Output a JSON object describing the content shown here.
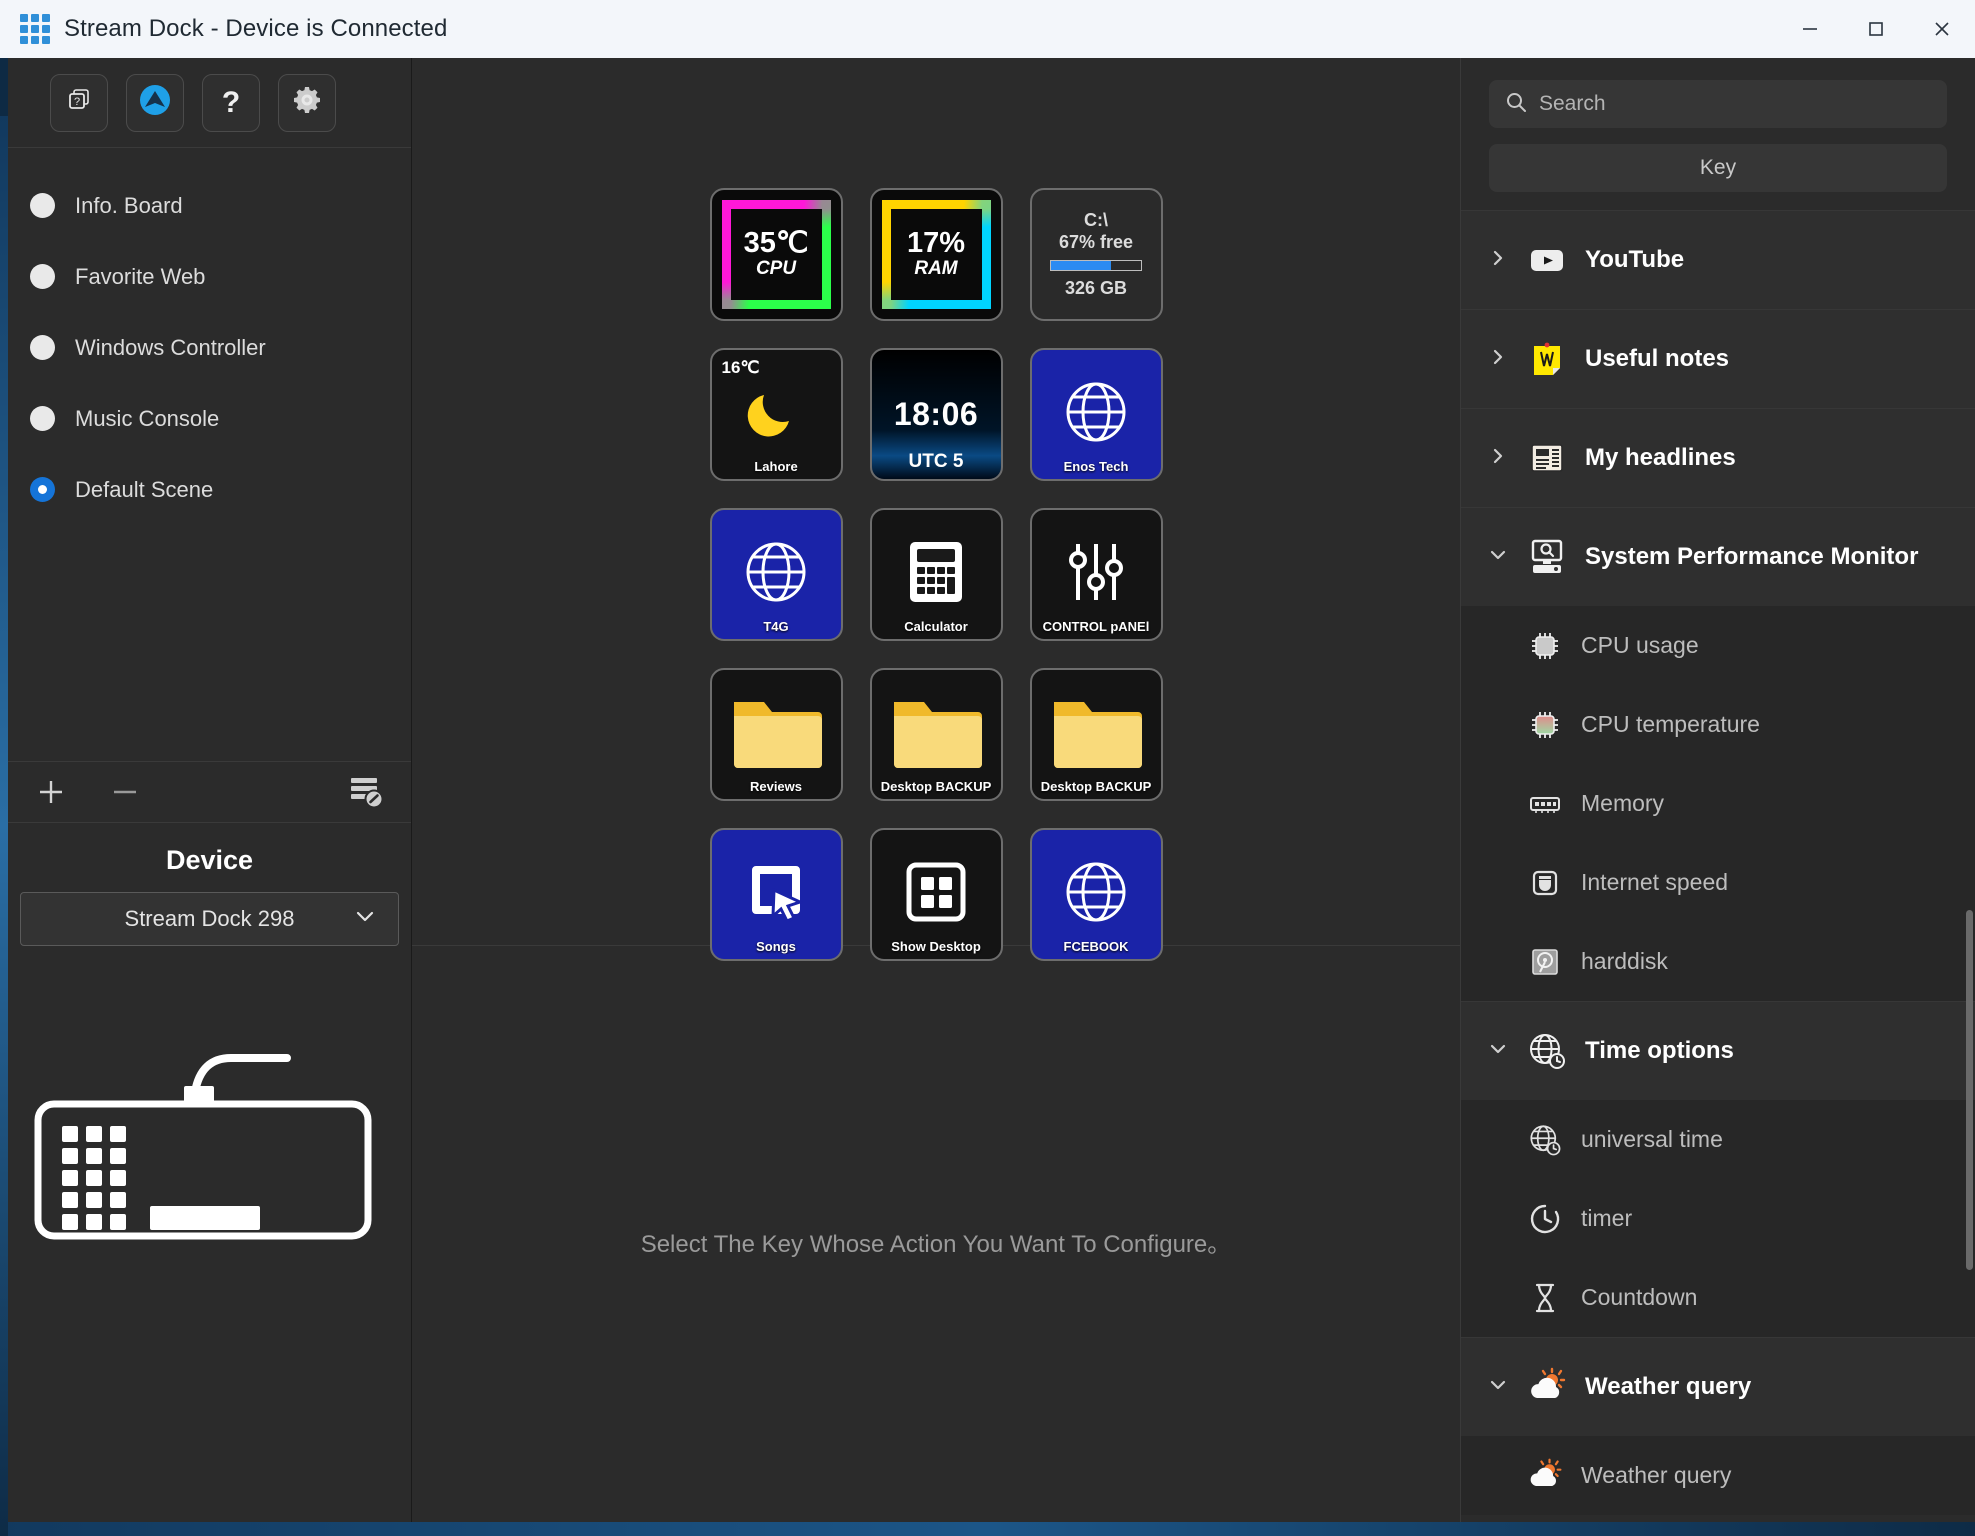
{
  "window": {
    "title": "Stream Dock - Device is Connected",
    "logo_icon": "grid-logo-icon",
    "minimize_label": "Minimize",
    "maximize_label": "Maximize",
    "close_label": "Close"
  },
  "left_toolbar": {
    "buttons": [
      {
        "name": "duplicate-button",
        "icon": "copy-layers-icon",
        "label": ""
      },
      {
        "name": "update-button",
        "icon": "upload-arrow-icon",
        "label": ""
      },
      {
        "name": "help-button",
        "icon": "question-mark-icon",
        "label": "?"
      },
      {
        "name": "settings-button",
        "icon": "gear-icon",
        "label": ""
      }
    ]
  },
  "scenes": {
    "items": [
      {
        "label": "Info. Board",
        "selected": false
      },
      {
        "label": "Favorite Web",
        "selected": false
      },
      {
        "label": "Windows Controller",
        "selected": false
      },
      {
        "label": "Music Console",
        "selected": false
      },
      {
        "label": "Default Scene",
        "selected": true
      }
    ]
  },
  "scene_actions": {
    "add_label": "+",
    "remove_label": "–",
    "config_icon": "list-edit-icon"
  },
  "device": {
    "title": "Device",
    "selected": "Stream Dock 298",
    "chevron_icon": "chevron-down-icon",
    "illustration_icon": "keyboard-device-icon"
  },
  "keygrid": {
    "keys": [
      {
        "name": "key-cpu-temp",
        "type": "neon-cpu",
        "big": "35℃",
        "sub": "CPU",
        "label": ""
      },
      {
        "name": "key-ram-usage",
        "type": "neon-ram",
        "big": "17%",
        "sub": "RAM",
        "label": ""
      },
      {
        "name": "key-disk-c",
        "type": "disk",
        "line1": "C:\\",
        "line2": "67% free",
        "line3": "326 GB",
        "bar_percent": 67,
        "label": ""
      },
      {
        "name": "key-weather-lahore",
        "type": "weather",
        "temp": "16℃",
        "icon": "moon-icon",
        "label": "Lahore"
      },
      {
        "name": "key-clock-utc5",
        "type": "clock",
        "time": "18:06",
        "zone": "UTC 5",
        "label": ""
      },
      {
        "name": "key-web-enos-tech",
        "type": "web",
        "icon": "globe-icon",
        "label": "Enos Tech"
      },
      {
        "name": "key-web-t4g",
        "type": "web",
        "icon": "globe-icon",
        "label": "T4G"
      },
      {
        "name": "key-calculator",
        "type": "app",
        "icon": "calculator-icon",
        "label": "Calculator"
      },
      {
        "name": "key-control-panel",
        "type": "app",
        "icon": "sliders-icon",
        "label": "CONTROL pANEl"
      },
      {
        "name": "key-folder-reviews",
        "type": "folder",
        "icon": "folder-icon",
        "label": "Reviews"
      },
      {
        "name": "key-folder-desktop-backup-1",
        "type": "folder",
        "icon": "folder-icon",
        "label": "Desktop BACKUP"
      },
      {
        "name": "key-folder-desktop-backup-2",
        "type": "folder",
        "icon": "folder-icon",
        "label": "Desktop BACKUP"
      },
      {
        "name": "key-songs",
        "type": "shortcut",
        "icon": "cursor-square-icon",
        "label": "Songs"
      },
      {
        "name": "key-show-desktop",
        "type": "app",
        "icon": "show-desktop-icon",
        "label": "Show Desktop"
      },
      {
        "name": "key-web-fcebook",
        "type": "web",
        "icon": "globe-icon",
        "label": "FCEBOOK"
      }
    ]
  },
  "config_panel": {
    "placeholder": "Select The Key Whose Action You Want To Configure。"
  },
  "right_panel": {
    "search": {
      "placeholder": "Search",
      "value": "",
      "icon": "search-icon"
    },
    "key_button": "Key",
    "categories": [
      {
        "label": "YouTube",
        "icon": "youtube-icon",
        "expanded": false,
        "chevron": "chevron-right-icon",
        "items": []
      },
      {
        "label": "Useful notes",
        "icon": "sticky-note-icon",
        "expanded": false,
        "chevron": "chevron-right-icon",
        "items": []
      },
      {
        "label": "My headlines",
        "icon": "newspaper-icon",
        "expanded": false,
        "chevron": "chevron-right-icon",
        "items": []
      },
      {
        "label": "System Performance Monitor",
        "icon": "monitor-search-icon",
        "expanded": true,
        "chevron": "chevron-down-icon",
        "items": [
          {
            "label": "CPU usage",
            "icon": "cpu-chip-icon"
          },
          {
            "label": "CPU temperature",
            "icon": "cpu-chip-temp-icon"
          },
          {
            "label": "Memory",
            "icon": "ram-stick-icon"
          },
          {
            "label": "Internet speed",
            "icon": "network-icon"
          },
          {
            "label": "harddisk",
            "icon": "harddisk-icon"
          }
        ]
      },
      {
        "label": "Time options",
        "icon": "globe-clock-icon",
        "expanded": true,
        "chevron": "chevron-down-icon",
        "items": [
          {
            "label": "universal time",
            "icon": "globe-clock-icon"
          },
          {
            "label": "timer",
            "icon": "clock-icon"
          },
          {
            "label": "Countdown",
            "icon": "hourglass-icon"
          }
        ]
      },
      {
        "label": "Weather query",
        "icon": "sun-cloud-icon",
        "expanded": true,
        "chevron": "chevron-down-icon",
        "items": [
          {
            "label": "Weather query",
            "icon": "sun-cloud-icon"
          }
        ]
      }
    ]
  },
  "colors": {
    "accent": "#1574d8",
    "titlebar_bg": "#f3f6fa",
    "panel_bg": "#2b2b2b",
    "key_blue": "#1a23a8",
    "folder_yellow": "#f7cf5c",
    "progress_blue": "#2b8bf2"
  }
}
